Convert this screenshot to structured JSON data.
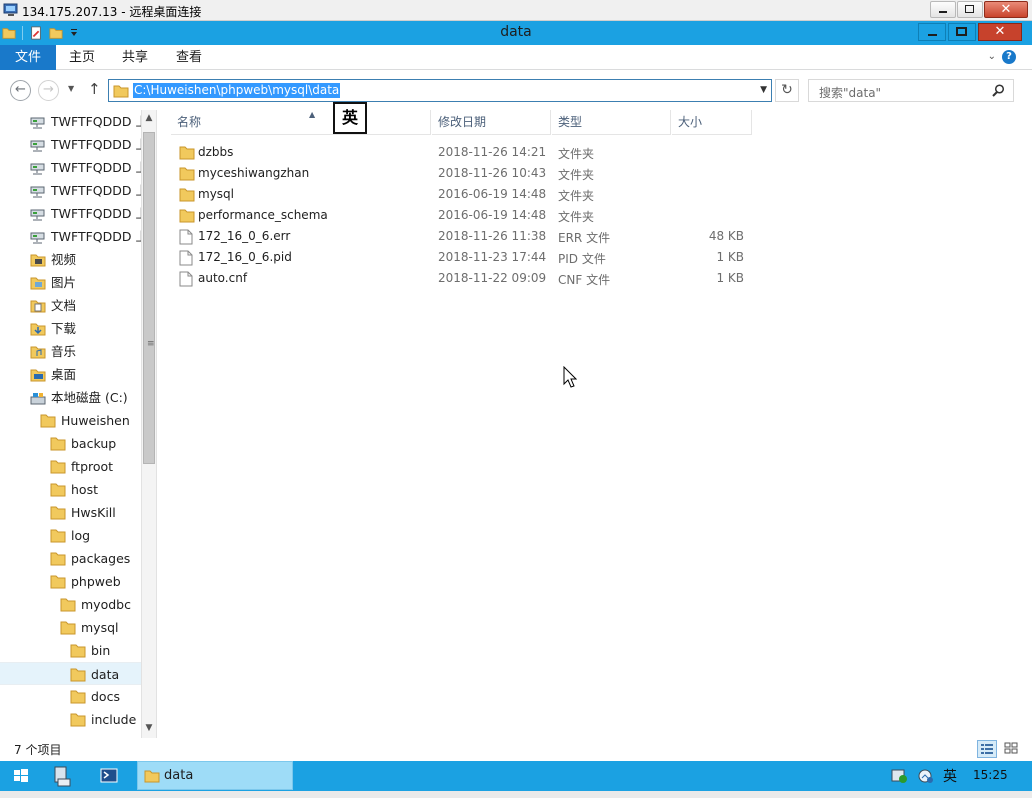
{
  "rdp": {
    "title": "134.175.207.13 - 远程桌面连接"
  },
  "window": {
    "title": "data"
  },
  "ribbon": {
    "tabs": [
      "文件",
      "主页",
      "共享",
      "查看"
    ],
    "help": "?"
  },
  "address": {
    "path": "C:\\Huweishen\\phpweb\\mysql\\data",
    "search_placeholder": "搜索\"data\""
  },
  "ime": {
    "badge": "英"
  },
  "tree": {
    "items": [
      {
        "label": "TWFTFQDDD 上",
        "icon": "network-drive-icon",
        "indent": 0
      },
      {
        "label": "TWFTFQDDD 上",
        "icon": "network-drive-icon",
        "indent": 0
      },
      {
        "label": "TWFTFQDDD 上",
        "icon": "network-drive-icon",
        "indent": 0
      },
      {
        "label": "TWFTFQDDD 上",
        "icon": "network-drive-icon",
        "indent": 0
      },
      {
        "label": "TWFTFQDDD 上",
        "icon": "network-drive-icon",
        "indent": 0
      },
      {
        "label": "TWFTFQDDD 上",
        "icon": "network-drive-icon",
        "indent": 0
      },
      {
        "label": "视频",
        "icon": "videos-icon",
        "indent": 0
      },
      {
        "label": "图片",
        "icon": "pictures-icon",
        "indent": 0
      },
      {
        "label": "文档",
        "icon": "documents-icon",
        "indent": 0
      },
      {
        "label": "下载",
        "icon": "downloads-icon",
        "indent": 0
      },
      {
        "label": "音乐",
        "icon": "music-icon",
        "indent": 0
      },
      {
        "label": "桌面",
        "icon": "desktop-icon",
        "indent": 0
      },
      {
        "label": "本地磁盘 (C:)",
        "icon": "local-disk-icon",
        "indent": 0
      },
      {
        "label": "Huweishen",
        "icon": "folder-icon",
        "indent": 1
      },
      {
        "label": "backup",
        "icon": "folder-icon",
        "indent": 2
      },
      {
        "label": "ftproot",
        "icon": "folder-icon",
        "indent": 2
      },
      {
        "label": "host",
        "icon": "folder-icon",
        "indent": 2
      },
      {
        "label": "HwsKill",
        "icon": "folder-icon",
        "indent": 2
      },
      {
        "label": "log",
        "icon": "folder-icon",
        "indent": 2
      },
      {
        "label": "packages",
        "icon": "folder-icon",
        "indent": 2
      },
      {
        "label": "phpweb",
        "icon": "folder-icon",
        "indent": 2
      },
      {
        "label": "myodbc",
        "icon": "folder-icon",
        "indent": 3
      },
      {
        "label": "mysql",
        "icon": "folder-icon",
        "indent": 3
      },
      {
        "label": "bin",
        "icon": "folder-icon",
        "indent": 4
      },
      {
        "label": "data",
        "icon": "folder-icon",
        "indent": 4,
        "selected": true
      },
      {
        "label": "docs",
        "icon": "folder-icon",
        "indent": 4
      },
      {
        "label": "include",
        "icon": "folder-icon",
        "indent": 4
      }
    ]
  },
  "columns": {
    "name": "名称",
    "date": "修改日期",
    "type": "类型",
    "size": "大小"
  },
  "files": [
    {
      "name": "dzbbs",
      "date": "2018-11-26 14:21",
      "type": "文件夹",
      "size": "",
      "icon": "folder-icon"
    },
    {
      "name": "myceshiwangzhan",
      "date": "2018-11-26 10:43",
      "type": "文件夹",
      "size": "",
      "icon": "folder-icon"
    },
    {
      "name": "mysql",
      "date": "2016-06-19 14:48",
      "type": "文件夹",
      "size": "",
      "icon": "folder-icon"
    },
    {
      "name": "performance_schema",
      "date": "2016-06-19 14:48",
      "type": "文件夹",
      "size": "",
      "icon": "folder-icon"
    },
    {
      "name": "172_16_0_6.err",
      "date": "2018-11-26 11:38",
      "type": "ERR 文件",
      "size": "48 KB",
      "icon": "file-icon"
    },
    {
      "name": "172_16_0_6.pid",
      "date": "2018-11-23 17:44",
      "type": "PID 文件",
      "size": "1 KB",
      "icon": "file-icon"
    },
    {
      "name": "auto.cnf",
      "date": "2018-11-22 09:09",
      "type": "CNF 文件",
      "size": "1 KB",
      "icon": "file-icon"
    }
  ],
  "status": {
    "count": "7 个项目"
  },
  "taskbar": {
    "task_label": "data",
    "ime": "英",
    "clock": "15:25"
  },
  "colors": {
    "accent": "#1ba1e2",
    "file_tab": "#1979ca",
    "selection": "#3399ff",
    "close": "#c7422c"
  }
}
